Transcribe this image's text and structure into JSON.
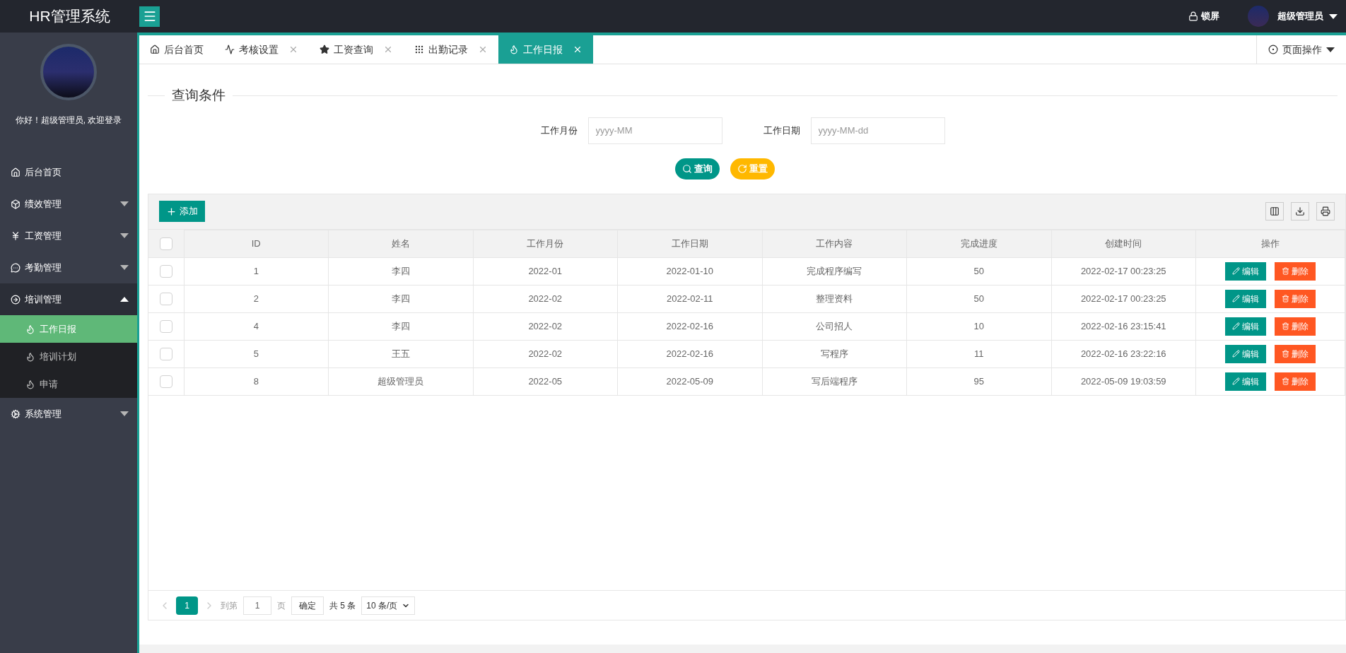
{
  "topbar": {
    "title": "HR管理系统",
    "lock": "锁屏",
    "user": "超级管理员"
  },
  "tabs": [
    {
      "label": "后台首页",
      "closable": false,
      "selected": false
    },
    {
      "label": "考核设置",
      "closable": true,
      "selected": false
    },
    {
      "label": "工资查询",
      "closable": true,
      "selected": false
    },
    {
      "label": "出勤记录",
      "closable": true,
      "selected": false
    },
    {
      "label": "工作日报",
      "closable": true,
      "selected": true
    }
  ],
  "page_actions": "页面操作",
  "sidebar": {
    "greeting": "你好！超级管理员, 欢迎登录",
    "items": [
      {
        "label": "后台首页",
        "expanded": false,
        "has_children": false
      },
      {
        "label": "绩效管理",
        "expanded": false,
        "has_children": true
      },
      {
        "label": "工资管理",
        "expanded": false,
        "has_children": true
      },
      {
        "label": "考勤管理",
        "expanded": false,
        "has_children": true
      },
      {
        "label": "培训管理",
        "expanded": true,
        "has_children": true,
        "children": [
          {
            "label": "工作日报",
            "selected": true
          },
          {
            "label": "培训计划",
            "selected": false
          },
          {
            "label": "申请",
            "selected": false
          }
        ]
      },
      {
        "label": "系统管理",
        "expanded": false,
        "has_children": true
      }
    ]
  },
  "query": {
    "title": "查询条件",
    "fields": [
      {
        "label": "工作月份",
        "placeholder": "yyyy-MM"
      },
      {
        "label": "工作日期",
        "placeholder": "yyyy-MM-dd"
      }
    ],
    "buttons": [
      {
        "kind": "search",
        "label": "查询"
      },
      {
        "kind": "reset",
        "label": "重置"
      }
    ]
  },
  "table": {
    "add": "添加",
    "all_checked": false,
    "columns": [
      "ID",
      "姓名",
      "工作月份",
      "工作日期",
      "工作内容",
      "完成进度",
      "创建时间",
      "操作"
    ],
    "rows": [
      {
        "checked": false,
        "cells": [
          "1",
          "李四",
          "2022-01",
          "2022-01-10",
          "完成程序编写",
          "50",
          "2022-02-17 00:23:25"
        ]
      },
      {
        "checked": false,
        "cells": [
          "2",
          "李四",
          "2022-02",
          "2022-02-11",
          "整理资料",
          "50",
          "2022-02-17 00:23:25"
        ]
      },
      {
        "checked": false,
        "cells": [
          "4",
          "李四",
          "2022-02",
          "2022-02-16",
          "公司招人",
          "10",
          "2022-02-16 23:15:41"
        ]
      },
      {
        "checked": false,
        "cells": [
          "5",
          "王五",
          "2022-02",
          "2022-02-16",
          "写程序",
          "11",
          "2022-02-16 23:22:16"
        ]
      },
      {
        "checked": false,
        "cells": [
          "8",
          "超级管理员",
          "2022-05",
          "2022-05-09",
          "写后端程序",
          "95",
          "2022-05-09 19:03:59"
        ]
      }
    ],
    "actions": [
      {
        "edit": "编辑",
        "delete": "删除"
      },
      {
        "edit": "编辑",
        "delete": "删除"
      },
      {
        "edit": "编辑",
        "delete": "删除"
      },
      {
        "edit": "编辑",
        "delete": "删除"
      },
      {
        "edit": "编辑",
        "delete": "删除"
      }
    ]
  },
  "pagination": {
    "pages": [
      {
        "label": "1",
        "selected": true
      }
    ],
    "goto_before": "到第",
    "goto_value": "1",
    "goto_after": "页",
    "confirm": "确定",
    "total": "共 5 条",
    "page_size": "10 条/页"
  }
}
